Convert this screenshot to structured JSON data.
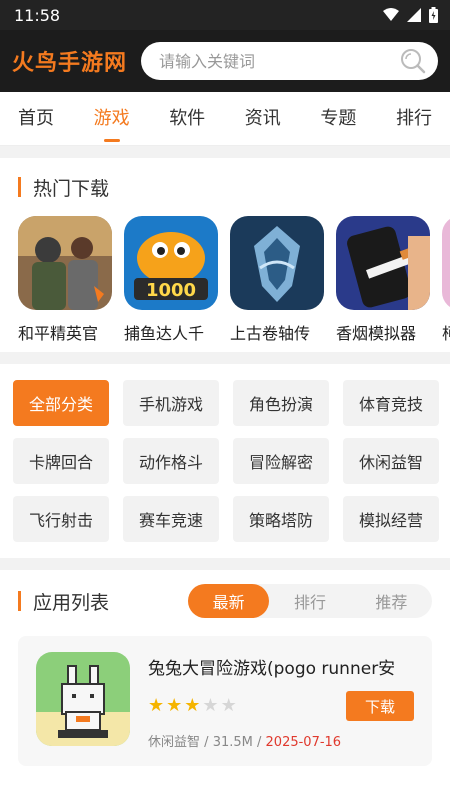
{
  "status": {
    "time": "11:58"
  },
  "header": {
    "logo": "火鸟手游网",
    "search_placeholder": "请输入关键词"
  },
  "nav": {
    "tabs": [
      "首页",
      "游戏",
      "软件",
      "资讯",
      "专题",
      "排行"
    ],
    "active": "游戏"
  },
  "hot": {
    "title": "热门下载",
    "items": [
      {
        "name": "和平精英官"
      },
      {
        "name": "捕鱼达人千"
      },
      {
        "name": "上古卷轴传"
      },
      {
        "name": "香烟模拟器"
      },
      {
        "name": "柯"
      }
    ]
  },
  "categories": [
    "全部分类",
    "手机游戏",
    "角色扮演",
    "体育竞技",
    "卡牌回合",
    "动作格斗",
    "冒险解密",
    "休闲益智",
    "飞行射击",
    "赛车竞速",
    "策略塔防",
    "模拟经营"
  ],
  "applist": {
    "title": "应用列表",
    "tabs": [
      "最新",
      "排行",
      "推荐"
    ],
    "apps": [
      {
        "name": "兔兔大冒险游戏(pogo runner安",
        "rating": 3,
        "max_rating": 5,
        "category": "休闲益智",
        "size": "31.5M",
        "sep": "/",
        "date": "2025-07-16",
        "button": "下载"
      }
    ]
  },
  "colors": {
    "accent": "#f47a1f",
    "header_bg": "#1c1c1c",
    "date": "#e0392d",
    "star": "#f5b400"
  }
}
